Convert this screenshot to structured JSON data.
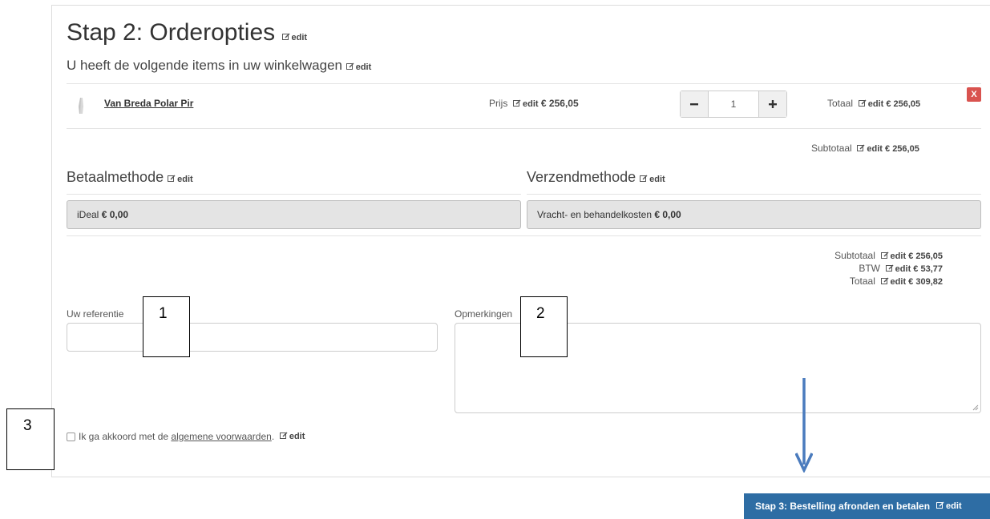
{
  "page": {
    "title": "Stap 2: Orderopties",
    "subtitle": "U heeft de volgende items in uw winkelwagen",
    "edit_label": "edit"
  },
  "cart": {
    "item": {
      "name": "Van Breda Polar Pir",
      "price_label": "Prijs",
      "price": "€ 256,05",
      "quantity": "1",
      "total_label": "Totaal",
      "total": "€ 256,05",
      "remove_label": "X"
    },
    "subtotal_label": "Subtotaal",
    "subtotal": "€ 256,05"
  },
  "payment": {
    "heading": "Betaalmethode",
    "selected_name": "iDeal",
    "selected_cost": "€ 0,00"
  },
  "shipping": {
    "heading": "Verzendmethode",
    "selected_name": "Vracht- en behandelkosten",
    "selected_cost": "€ 0,00"
  },
  "summary": {
    "subtotal_label": "Subtotaal",
    "subtotal": "€ 256,05",
    "vat_label": "BTW",
    "vat": "€ 53,77",
    "total_label": "Totaal",
    "total": "€ 309,82"
  },
  "form": {
    "reference_label": "Uw referentie",
    "reference_value": "",
    "remarks_label": "Opmerkingen",
    "remarks_value": ""
  },
  "terms": {
    "prefix": "Ik ga akkoord met de ",
    "link": "algemene voorwaarden",
    "suffix": "."
  },
  "submit": {
    "label": "Stap 3: Bestelling afronden en betalen"
  },
  "annotations": {
    "callout_1": "1",
    "callout_2": "2",
    "callout_3": "3"
  },
  "colors": {
    "primary_button": "#2e6da4",
    "remove_button": "#d9534f",
    "arrow": "#4a7bbd"
  }
}
